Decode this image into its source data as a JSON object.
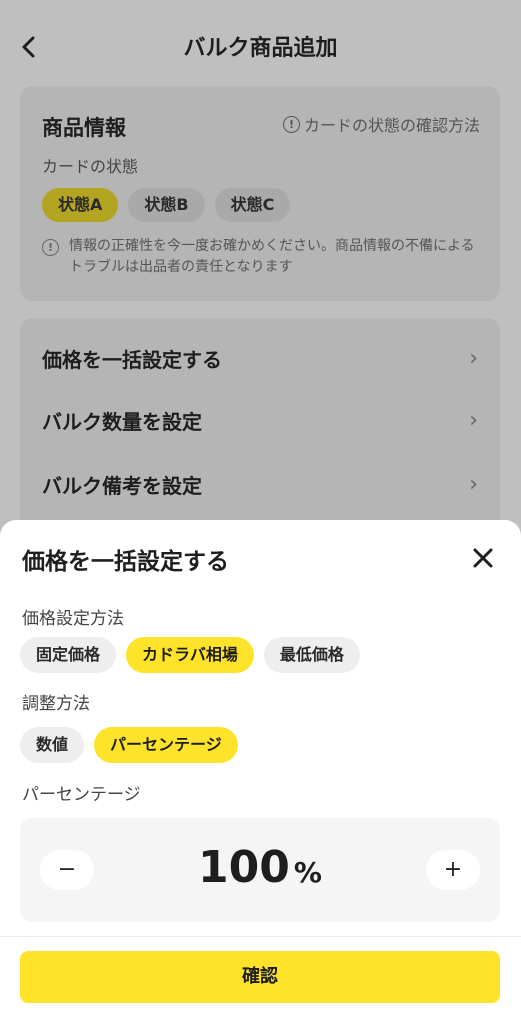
{
  "header": {
    "back_icon": "‹",
    "title": "バルク商品追加"
  },
  "product_info": {
    "title": "商品情報",
    "help_link": "カードの状態の確認方法",
    "condition_label": "カードの状態",
    "conditions": [
      "状態A",
      "状態B",
      "状態C"
    ],
    "selected_condition": "状態A",
    "notice": "情報の正確性を今一度お確かめください。商品情報の不備によるトラブルは出品者の責任となります"
  },
  "settings": {
    "rows": [
      "価格を一括設定する",
      "バルク数量を設定",
      "バルク備考を設定"
    ]
  },
  "sheet": {
    "title": "価格を一括設定する",
    "method_label": "価格設定方法",
    "methods": [
      "固定価格",
      "カドラバ相場",
      "最低価格"
    ],
    "selected_method": "カドラバ相場",
    "adjust_label": "調整方法",
    "adjust_options": [
      "数値",
      "パーセンテージ"
    ],
    "selected_adjust": "パーセンテージ",
    "percent_label": "パーセンテージ",
    "minus": "−",
    "plus": "+",
    "value": "100",
    "unit": "%",
    "confirm": "確認"
  },
  "colors": {
    "accent": "#ffe32a",
    "overlay": "#bfbfbf"
  }
}
